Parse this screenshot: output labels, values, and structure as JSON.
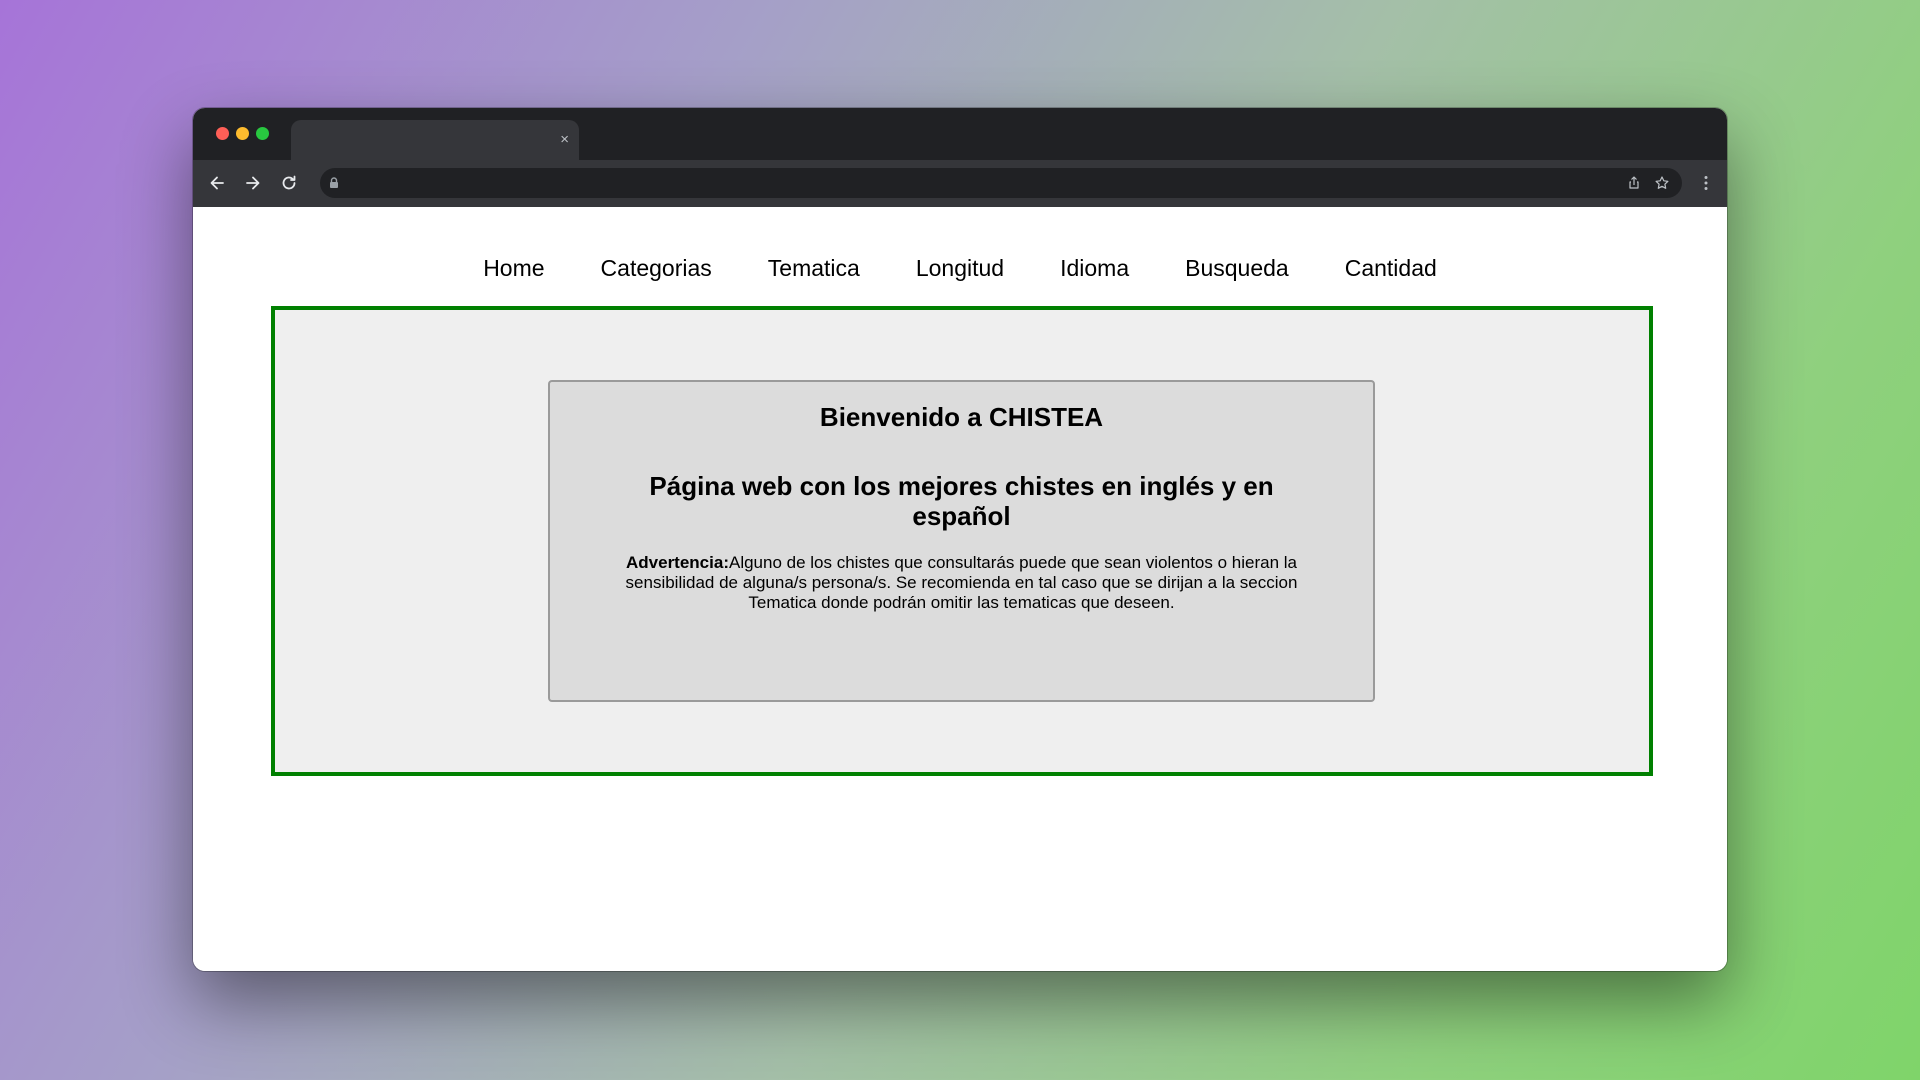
{
  "browser": {
    "tab_close": "×",
    "icons": {
      "back": "arrow-left-icon",
      "forward": "arrow-right-icon",
      "reload": "reload-icon",
      "lock": "lock-icon",
      "share": "share-icon",
      "bookmark": "star-icon",
      "menu": "kebab-menu-icon"
    }
  },
  "nav": {
    "items": [
      "Home",
      "Categorias",
      "Tematica",
      "Longitud",
      "Idioma",
      "Busqueda",
      "Cantidad"
    ]
  },
  "main": {
    "title": "Bienvenido a CHISTEA",
    "subtitle": "Página web con los mejores chistes en inglés y en español",
    "warning_label": "Advertencia:",
    "warning_text": "Alguno de los chistes que consultarás puede que sean violentos o hieran la sensibilidad de alguna/s persona/s. Se recomienda en tal caso que se dirijan a la seccion Tematica donde podrán omitir las tematicas que deseen."
  },
  "colors": {
    "frame_border": "#008000",
    "frame_bg": "#efefef",
    "card_bg": "#dcdcdc"
  }
}
